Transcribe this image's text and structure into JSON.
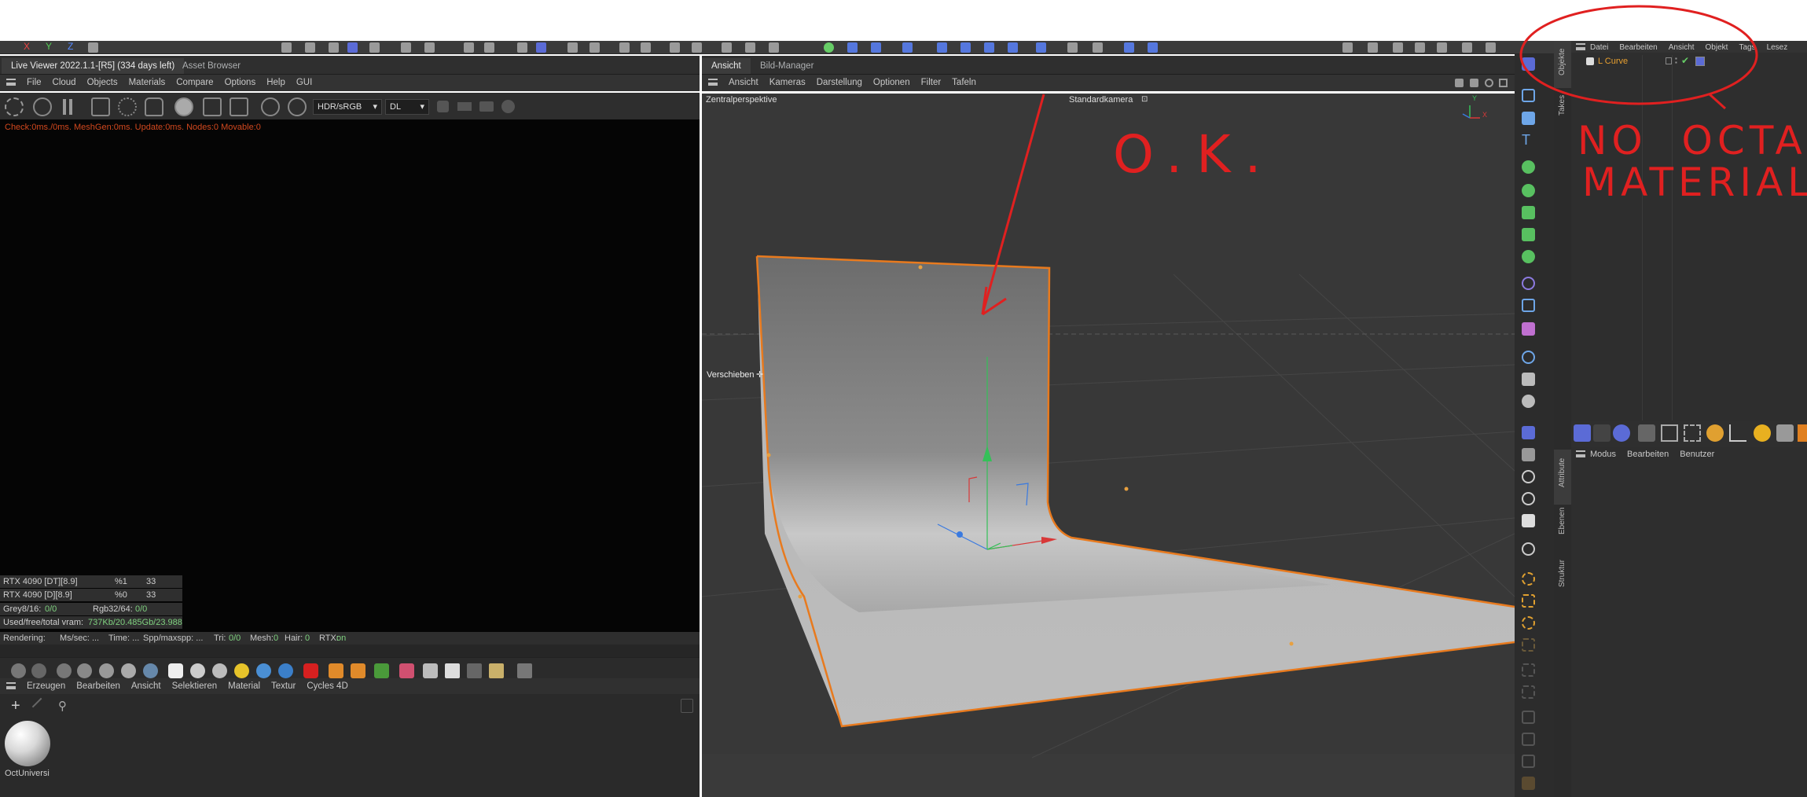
{
  "live_viewer": {
    "tab_title": "Live Viewer 2022.1.1-[R5] (334 days left)",
    "tab_asset": "Asset Browser",
    "menu": [
      "File",
      "Cloud",
      "Objects",
      "Materials",
      "Compare",
      "Options",
      "Help",
      "GUI"
    ],
    "color_space": "HDR/sRGB",
    "kernel": "DL",
    "status_line": "Check:0ms./0ms. MeshGen:0ms. Update:0ms. Nodes:0 Movable:0",
    "gpu_rows": [
      {
        "name": "RTX 4090 [DT][8.9]",
        "pct": "%1",
        "val": "33"
      },
      {
        "name": "RTX 4090 [D][8.9]",
        "pct": "%0",
        "val": "33"
      }
    ],
    "grey_label": "Grey8/16:",
    "grey_value": "0/0",
    "rgb_label": "Rgb32/64:",
    "rgb_value": "0/0",
    "vram_label": "Used/free/total vram:",
    "vram_value": "737Kb/20.485Gb/23.988",
    "render_labels": {
      "rendering": "Rendering:",
      "mssec": "Ms/sec: ...",
      "time": "Time: ...",
      "spp": "Spp/maxspp: ...",
      "tri": "Tri:",
      "tri_val": "0/0",
      "mesh": "Mesh:",
      "mesh_val": "0",
      "hair": "Hair:",
      "hair_val": "0",
      "rtx": "RTX:",
      "rtx_val": "on"
    }
  },
  "material_manager": {
    "menu": [
      "Erzeugen",
      "Bearbeiten",
      "Ansicht",
      "Selektieren",
      "Material",
      "Textur",
      "Cycles 4D"
    ],
    "material_name": "OctUniversi"
  },
  "viewport": {
    "tabs": [
      "Ansicht",
      "Bild-Manager"
    ],
    "menu": [
      "Ansicht",
      "Kameras",
      "Darstellung",
      "Optionen",
      "Filter",
      "Tafeln"
    ],
    "projection": "Zentralperspektive",
    "camera": "Standardkamera",
    "move_label": "Verschieben",
    "axis_x": "X",
    "axis_y": "Y",
    "axis_z": "Z"
  },
  "object_manager": {
    "menu": [
      "Datei",
      "Bearbeiten",
      "Ansicht",
      "Objekt",
      "Tags",
      "Lesez"
    ],
    "object_name": "L Curve"
  },
  "attribute_manager": {
    "menu": [
      "Modus",
      "Bearbeiten",
      "Benutzer"
    ]
  },
  "side_tabs": [
    "Objekte",
    "Takes",
    "Attribute",
    "Ebenen",
    "Struktur"
  ],
  "annotations": {
    "ok": "O.K.",
    "no_octane_1": "NO  OCTANE",
    "no_octane_2": "MATERIAL"
  },
  "colors": {
    "accent": "#5b6bd6",
    "selection": "#e87a1e",
    "annotation": "#e02020"
  }
}
